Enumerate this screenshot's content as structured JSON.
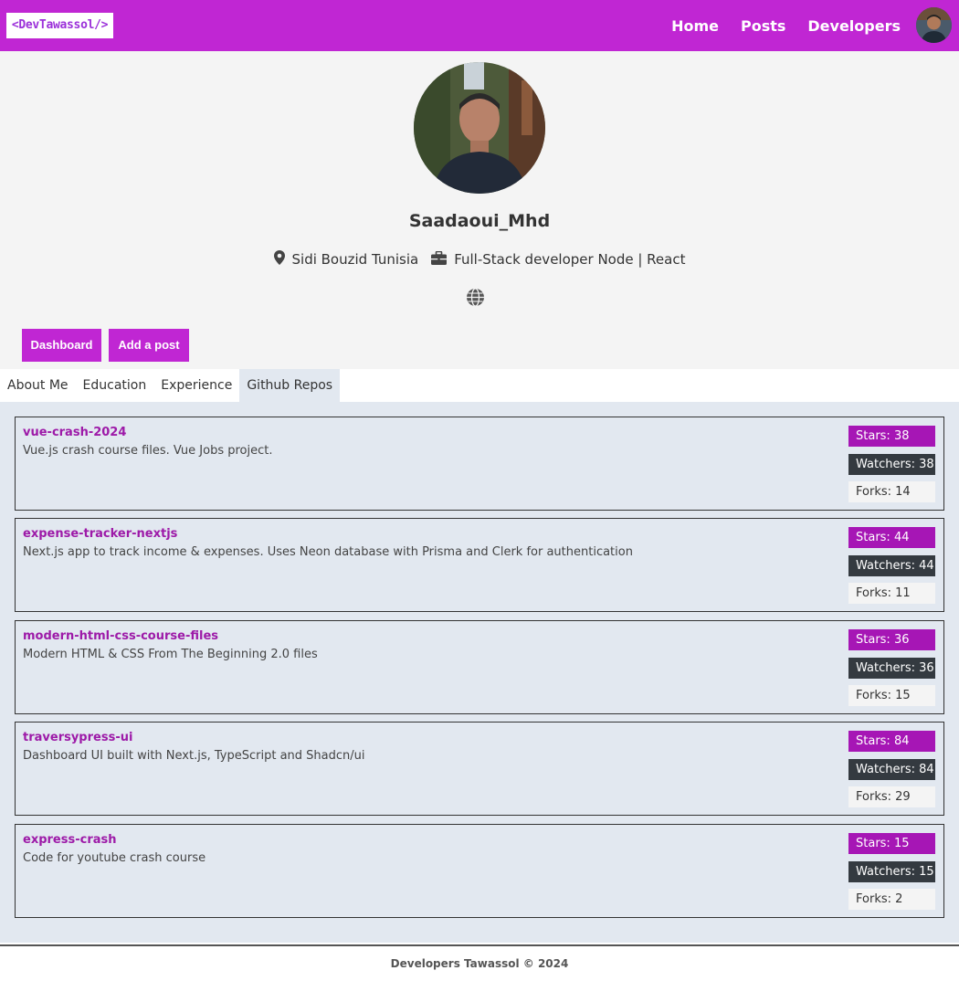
{
  "brand": {
    "logo_text": "<DevTawassol/>"
  },
  "nav": {
    "links": [
      "Home",
      "Posts",
      "Developers"
    ]
  },
  "profile": {
    "name": "Saadaoui_Mhd",
    "location": "Sidi Bouzid Tunisia",
    "title": "Full-Stack developer Node | React"
  },
  "actions": {
    "dashboard": "Dashboard",
    "add_post": "Add a post"
  },
  "tabs": [
    "About Me",
    "Education",
    "Experience",
    "Github Repos"
  ],
  "active_tab": "Github Repos",
  "repos": [
    {
      "name": "vue-crash-2024",
      "description": "Vue.js crash course files. Vue Jobs project.",
      "stars": "Stars: 38",
      "watchers": "Watchers: 38",
      "forks": "Forks: 14"
    },
    {
      "name": "expense-tracker-nextjs",
      "description": "Next.js app to track income & expenses. Uses Neon database with Prisma and Clerk for authentication",
      "stars": "Stars: 44",
      "watchers": "Watchers: 44",
      "forks": "Forks: 11"
    },
    {
      "name": "modern-html-css-course-files",
      "description": "Modern HTML & CSS From The Beginning 2.0 files",
      "stars": "Stars: 36",
      "watchers": "Watchers: 36",
      "forks": "Forks: 15"
    },
    {
      "name": "traversypress-ui",
      "description": "Dashboard UI built with Next.js, TypeScript and Shadcn/ui",
      "stars": "Stars: 84",
      "watchers": "Watchers: 84",
      "forks": "Forks: 29"
    },
    {
      "name": "express-crash",
      "description": "Code for youtube crash course",
      "stars": "Stars: 15",
      "watchers": "Watchers: 15",
      "forks": "Forks: 2"
    }
  ],
  "footer": {
    "text": "Developers Tawassol © 2024"
  },
  "colors": {
    "primary": "#c026d3",
    "repo_name": "#9d1aa8",
    "stars_badge": "#a616b5",
    "watchers_badge": "#343a40",
    "panel_bg": "#e2e8f0"
  },
  "icons": {
    "location": "map-marker-icon",
    "title": "briefcase-icon",
    "website": "globe-icon"
  }
}
